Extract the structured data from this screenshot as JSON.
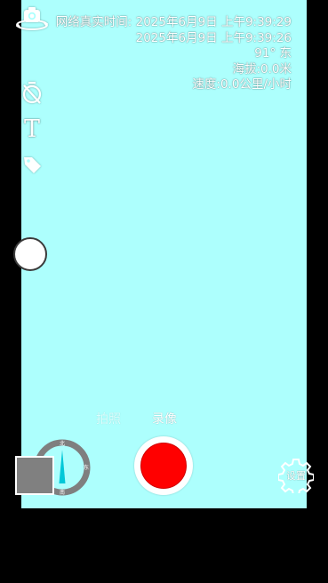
{
  "watermark": {
    "network_time": "网络真实时间: 2025年6月9日 上午9:39:29",
    "device_time": "2025年6月9日 上午9:39:26",
    "heading": "91° 东",
    "altitude": "海拔:0.0米",
    "speed": "速度:0.0公里/小时"
  },
  "side_toolbar": {
    "icons": [
      "camera-flip-icon",
      "timer-off-icon",
      "text-icon",
      "tag-icon"
    ],
    "text_glyph": "T"
  },
  "modes": {
    "tabs": [
      "拍照",
      "录像"
    ],
    "active": "录像"
  },
  "compass": {
    "north": "北",
    "south": "南",
    "east": "东",
    "heading_degrees": 91
  },
  "settings": {
    "label": "设置",
    "icon": "gear-icon"
  },
  "colors": {
    "viewfinder": "#adfffd",
    "record": "#ff0000",
    "thumbnail": "#808080",
    "needle": "#00c8d8"
  }
}
